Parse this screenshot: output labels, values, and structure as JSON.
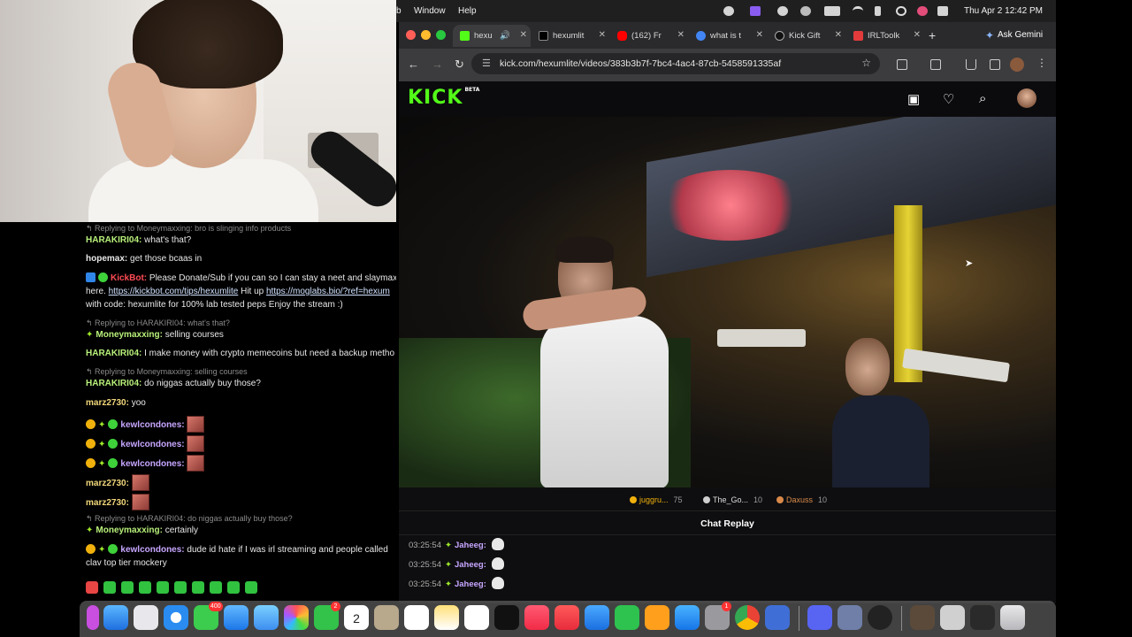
{
  "menubar": {
    "items": [
      "b",
      "Window",
      "Help"
    ],
    "date_time": "Thu Apr 2  12:42 PM"
  },
  "browser": {
    "tabs": [
      {
        "title": "hexu",
        "favicon_color": "#53fc18",
        "active": true
      },
      {
        "title": "hexumlit",
        "favicon_color": "#000000"
      },
      {
        "title": "(162) Fr",
        "favicon_color": "#ff0000"
      },
      {
        "title": "what is t",
        "favicon_color": "#4285f4"
      },
      {
        "title": "Kick Gift",
        "favicon_color": "#111111"
      },
      {
        "title": "IRLToolk",
        "favicon_color": "#e33b3b"
      }
    ],
    "new_tab_icon": "+",
    "ask_gemini_label": "Ask Gemini",
    "url": "kick.com/hexumlite/videos/383b3b7f-7bc4-4ac4-87cb-5458591335af"
  },
  "kick": {
    "logo": "KICK",
    "logo_badge": "BETA",
    "leaderboard": [
      {
        "name": "juggru...",
        "count": "75",
        "color": "#f0b10c"
      },
      {
        "name": "The_Go...",
        "count": "10",
        "color": "#cfcfcf"
      },
      {
        "name": "Daxuss",
        "count": "10",
        "color": "#d98a4a"
      }
    ],
    "replay_title": "Chat Replay",
    "replay_messages": [
      {
        "time": "03:25:54",
        "user": "Jaheeg:"
      },
      {
        "time": "03:25:54",
        "user": "Jaheeg:"
      },
      {
        "time": "03:25:54",
        "user": "Jaheeg:"
      }
    ]
  },
  "overlay_chat": [
    {
      "reply": "Replying to Moneymaxxing: bro is slinging info products"
    },
    {
      "user": "HARAKIRI04:",
      "text": "what's that?"
    },
    {
      "user": "hopemax:",
      "text": "get those bcaas in"
    },
    {
      "user": "KickBot:",
      "text": "Please Donate/Sub if you can so I can stay a neet and slaymax"
    },
    {
      "text": "here.",
      "link1": "https://kickbot.com/tips/hexumlite",
      "mid": "Hit up",
      "link2": "https://moglabs.bio/?ref=hexum"
    },
    {
      "text": "with code: hexumlite for 100% lab tested peps Enjoy the stream :)"
    },
    {
      "reply": "Replying to HARAKIRI04: what's that?"
    },
    {
      "user": "Moneymaxxing:",
      "text": "selling courses"
    },
    {
      "user": "HARAKIRI04:",
      "text": "I make money with crypto memecoins but need a backup metho"
    },
    {
      "reply": "Replying to Moneymaxxing: selling courses"
    },
    {
      "user": "HARAKIRI04:",
      "text": "do niggas actually buy those?"
    },
    {
      "user": "marz2730:",
      "text": "yoo"
    },
    {
      "user": "kewlcondones:"
    },
    {
      "user": "kewlcondones:"
    },
    {
      "user": "kewlcondones:"
    },
    {
      "user": "marz2730:"
    },
    {
      "user": "marz2730:"
    },
    {
      "reply": "Replying to HARAKIRI04: do niggas actually buy those?"
    },
    {
      "user": "Moneymaxxing:",
      "text": "certainly"
    },
    {
      "user": "kewlcondones:",
      "text": "dude id hate if I was irl streaming and people called"
    },
    {
      "text": "clav top tier mockery"
    }
  ],
  "dock": {
    "badges": {
      "calendar_day": "2",
      "photos": "400",
      "facetime": "2",
      "settings": "1"
    }
  },
  "colors": {
    "kick_green": "#53fc18",
    "menubar_bg": "#1f1f1f",
    "tab_bg": "#2a2a2c"
  }
}
